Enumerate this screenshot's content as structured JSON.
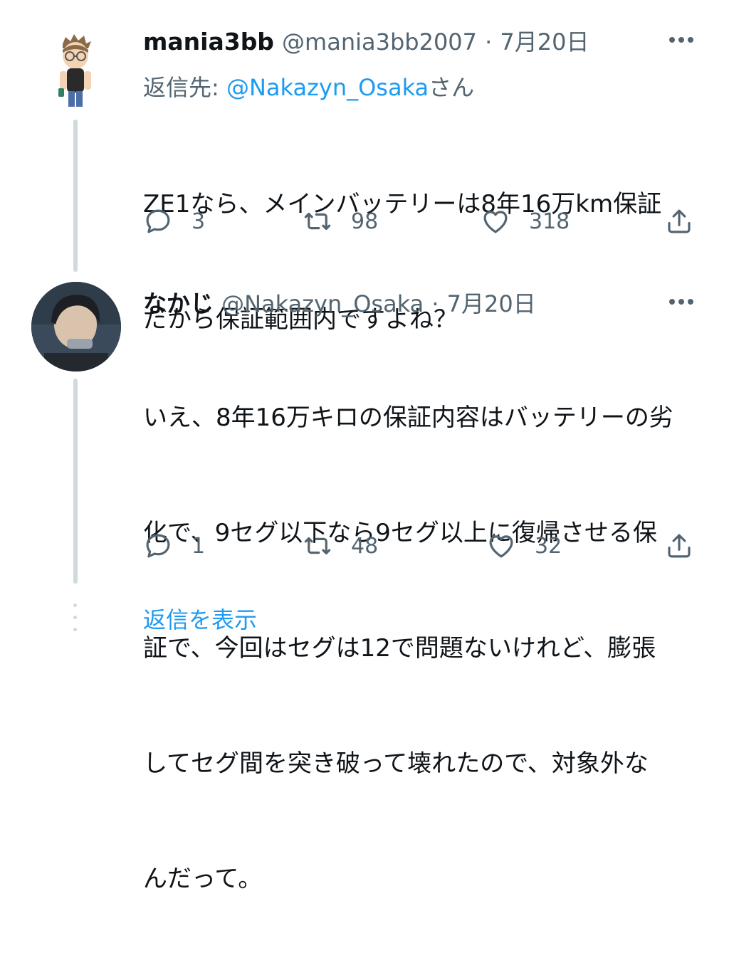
{
  "tweets": [
    {
      "display_name": "mania3bb",
      "handle": "@mania3bb2007",
      "separator": "·",
      "date": "7月20日",
      "reply_prefix": "返信先: ",
      "reply_mention": "@Nakazyn_Osaka",
      "reply_suffix": "さん",
      "text_lines": [
        "ZE1なら、メインバッテリーは8年16万km保証",
        "だから保証範囲内ですよね？"
      ],
      "replies": "3",
      "retweets": "98",
      "likes": "318"
    },
    {
      "display_name": "なかじ",
      "handle": "@Nakazyn_Osaka",
      "separator": "·",
      "date": "7月20日",
      "text_lines": [
        "いえ、8年16万キロの保証内容はバッテリーの劣",
        "化で、9セグ以下なら9セグ以上に復帰させる保",
        "証で、今回はセグは12で問題ないけれど、膨張",
        "してセグ間を突き破って壊れたので、対象外な",
        "んだって。"
      ],
      "replies": "1",
      "retweets": "48",
      "likes": "32"
    }
  ],
  "show_replies_label": "返信を表示",
  "colors": {
    "accent": "#1d9bf0",
    "text": "#0f1419",
    "muted": "#536471",
    "thread": "#cfd9de"
  },
  "icons": [
    "more-icon",
    "reply-icon",
    "retweet-icon",
    "like-icon",
    "share-icon"
  ]
}
